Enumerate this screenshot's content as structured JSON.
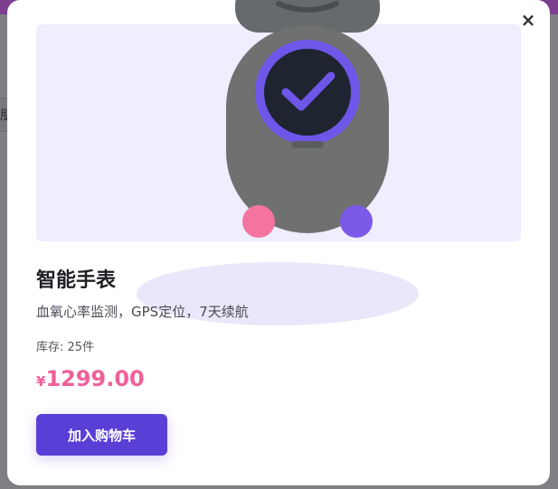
{
  "background": {
    "partial_label": "朋"
  },
  "modal": {
    "close_icon_glyph": "×",
    "product": {
      "title": "智能手表",
      "description": "血氧心率监测，GPS定位，7天续航",
      "stock": "库存: 25件",
      "currency": "¥",
      "price": "1299.00"
    },
    "add_to_cart_label": "加入购物车"
  },
  "colors": {
    "accent": "#5a3fd6",
    "price": "#f0609a",
    "image_panel_bg": "#efedfe",
    "robot_body": "#6f7070",
    "watch_ring": "#6e56e8",
    "watch_face": "#1e2430",
    "pink_dot": "#f5739f",
    "purple_dot": "#7b5ae8"
  }
}
